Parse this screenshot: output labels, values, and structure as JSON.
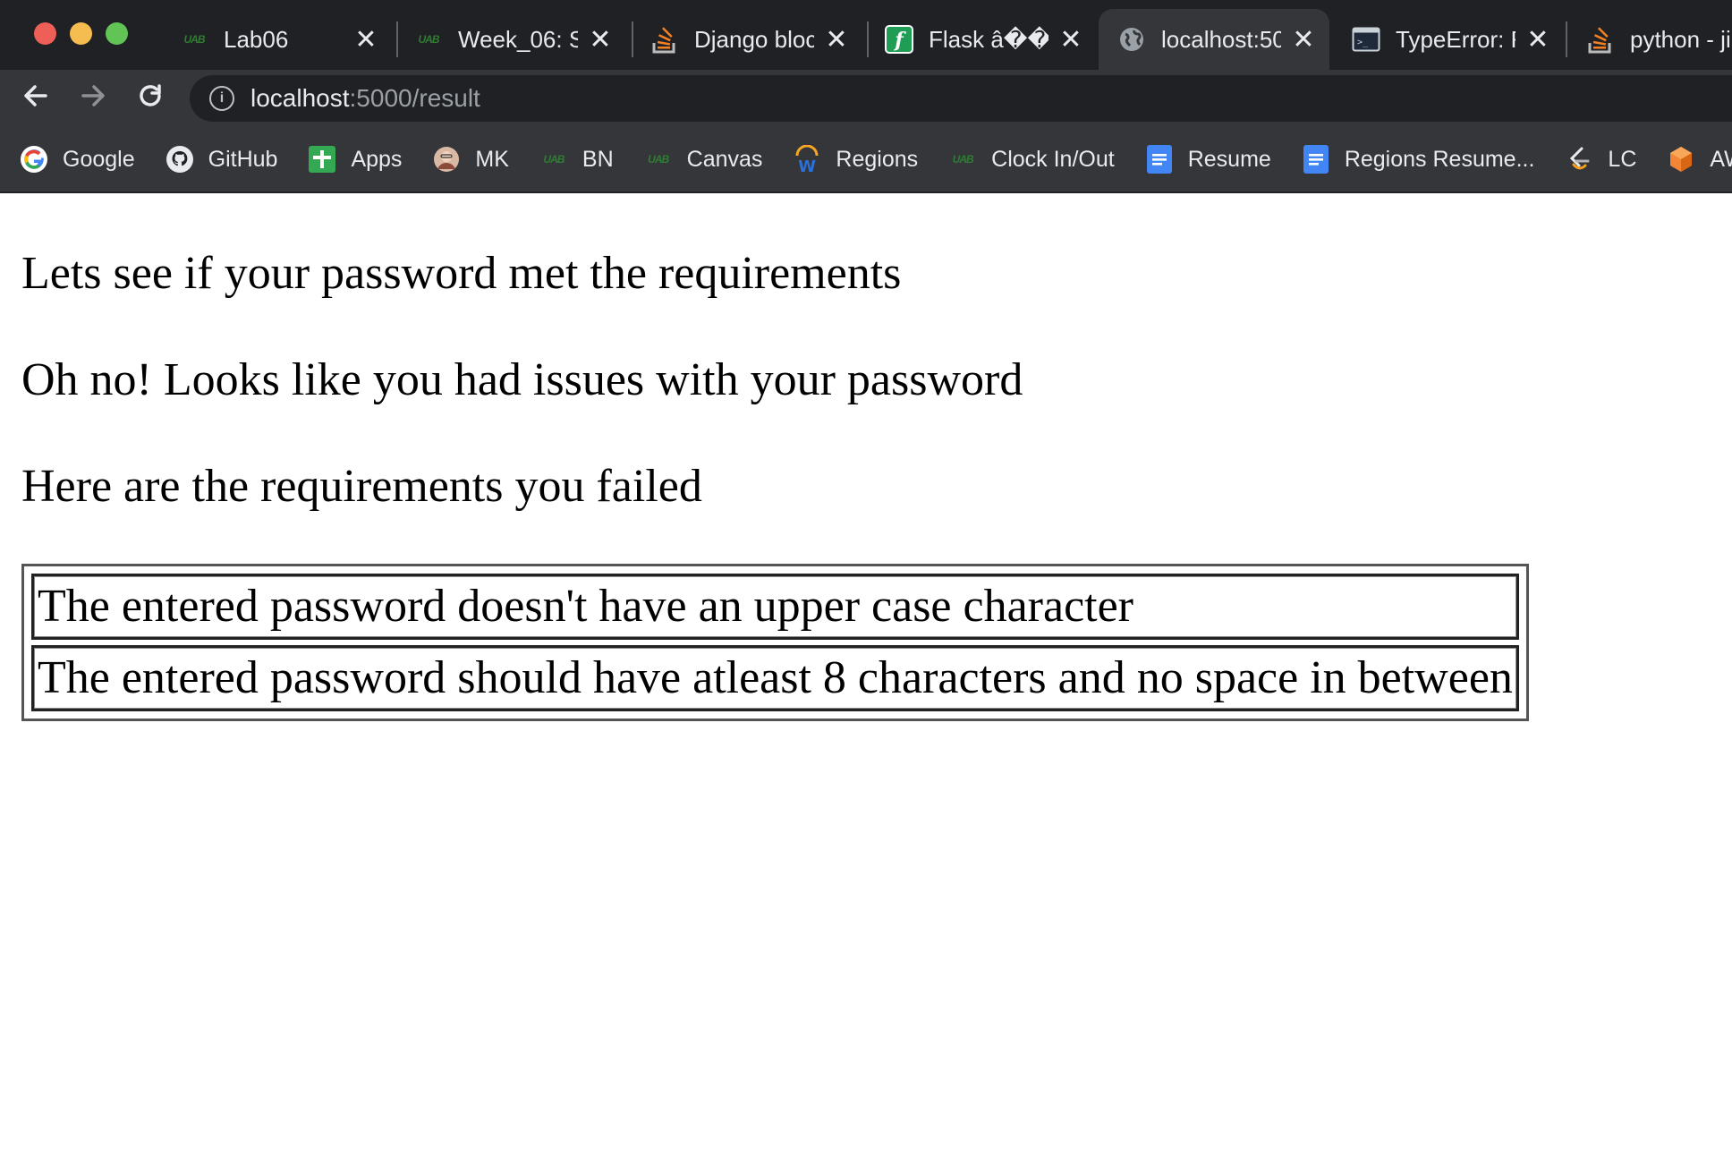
{
  "browser": {
    "tabs": [
      {
        "title": "Lab06",
        "icon": "uab-icon"
      },
      {
        "title": "Week_06: S",
        "icon": "uab-icon"
      },
      {
        "title": "Django bloc",
        "icon": "stackoverflow-icon"
      },
      {
        "title": "Flask â��",
        "icon": "flask-icon"
      },
      {
        "title": "localhost:50",
        "icon": "globe-icon",
        "active": true
      },
      {
        "title": "TypeError: F",
        "icon": "terminal-icon"
      },
      {
        "title": "python - ji",
        "icon": "stackoverflow-icon"
      }
    ],
    "url": {
      "host": "localhost",
      "path": ":5000/result"
    },
    "bookmarks": [
      {
        "label": "Google",
        "icon": "google-icon"
      },
      {
        "label": "GitHub",
        "icon": "github-icon"
      },
      {
        "label": "Apps",
        "icon": "apps-icon"
      },
      {
        "label": "MK",
        "icon": "avatar-icon"
      },
      {
        "label": "BN",
        "icon": "uab-icon"
      },
      {
        "label": "Canvas",
        "icon": "uab-icon"
      },
      {
        "label": "Regions",
        "icon": "workday-icon"
      },
      {
        "label": "Clock In/Out",
        "icon": "uab-icon"
      },
      {
        "label": "Resume",
        "icon": "docs-icon"
      },
      {
        "label": "Regions Resume...",
        "icon": "docs-icon"
      },
      {
        "label": "LC",
        "icon": "leetcode-icon"
      },
      {
        "label": "AWS",
        "icon": "aws-icon"
      }
    ],
    "colors": {
      "tabstrip": "#202124",
      "toolbar": "#35363a",
      "text": "#e8eaed"
    }
  },
  "page": {
    "intro": "Lets see if your password met the requirements",
    "issue": "Oh no! Looks like you had issues with your password",
    "failed_heading": "Here are the requirements you failed",
    "failures": [
      "The entered password doesn't have an upper case character",
      "The entered password should have atleast 8 characters and no space in between"
    ]
  }
}
